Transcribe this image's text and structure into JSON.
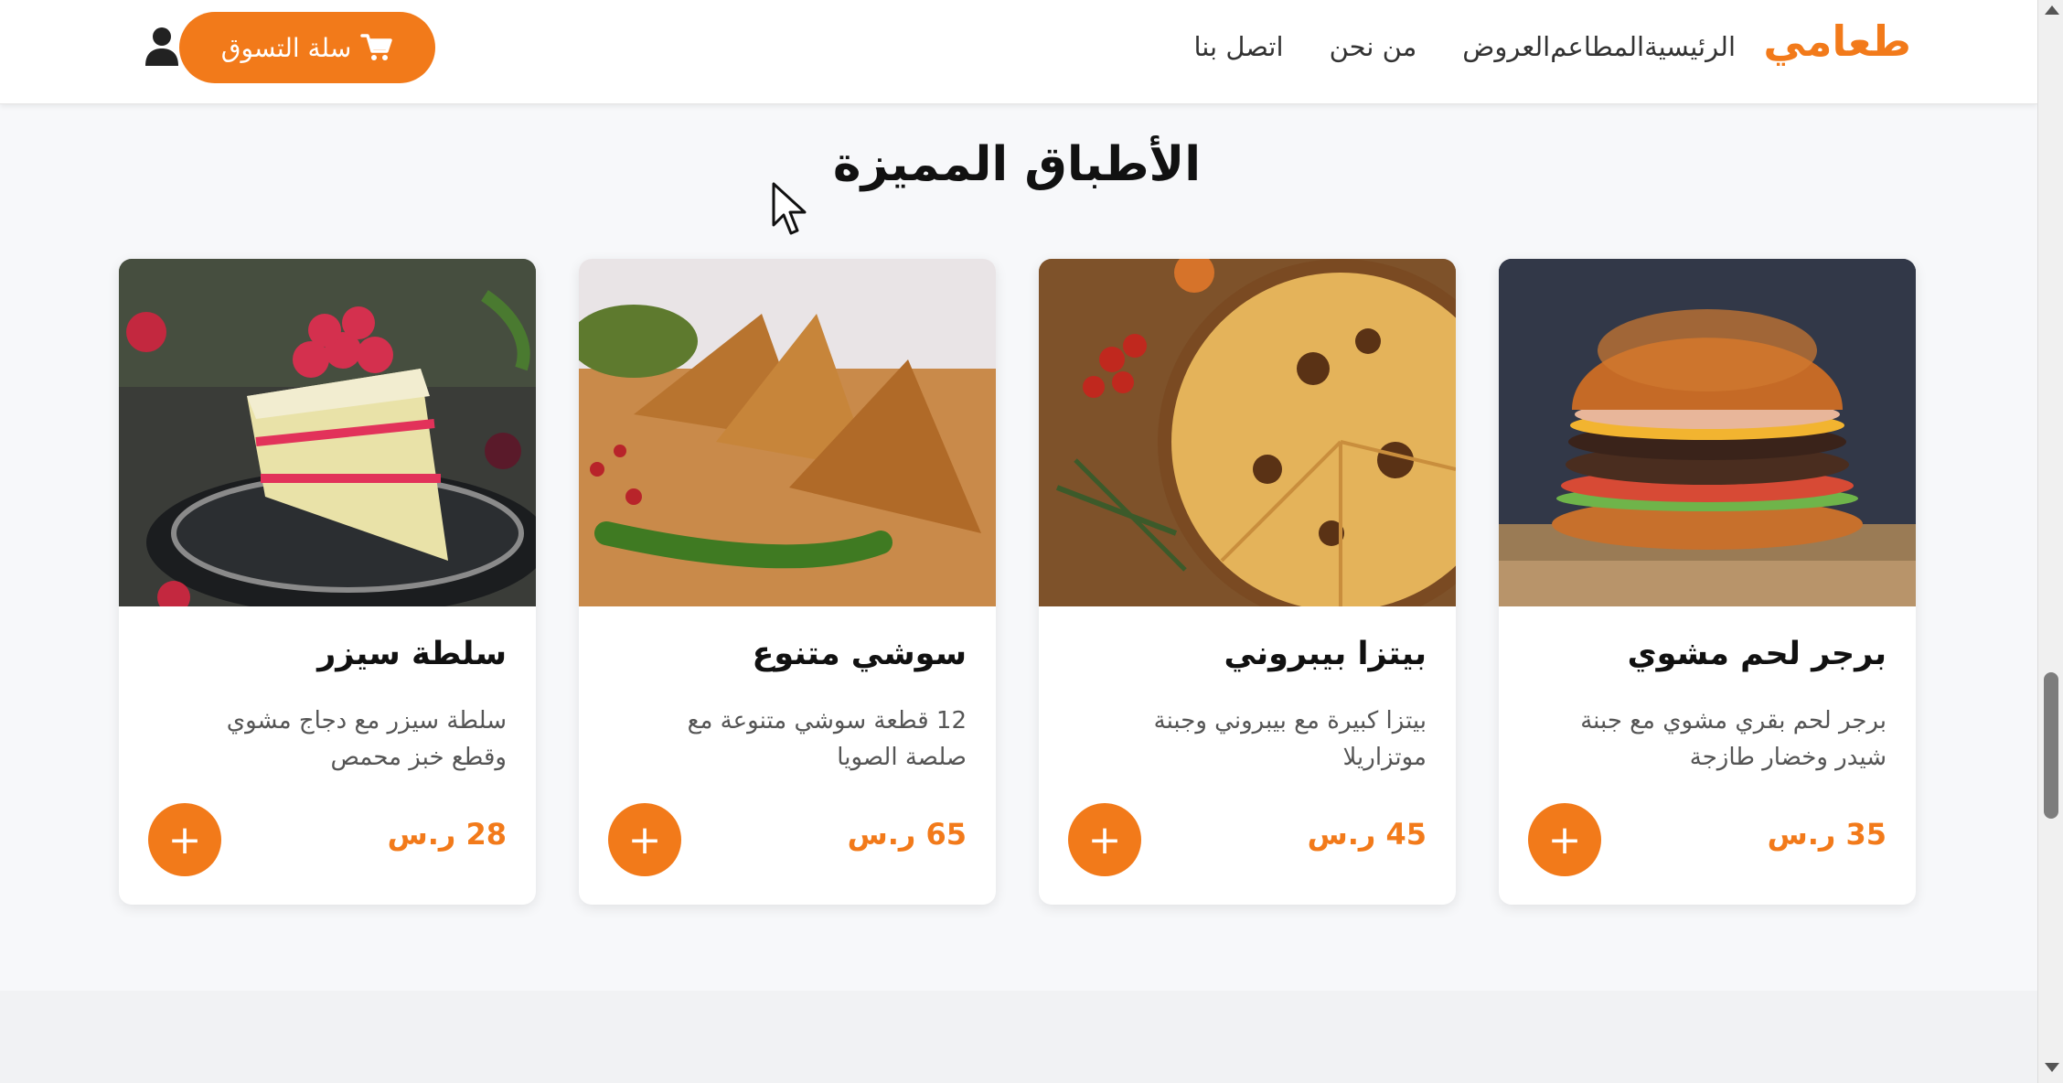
{
  "header": {
    "brand": "طعامي",
    "nav": [
      {
        "label": "الرئيسية"
      },
      {
        "label": "المطاعم"
      },
      {
        "label": "العروض"
      },
      {
        "label": "من نحن"
      },
      {
        "label": "اتصل بنا"
      }
    ],
    "cart_label": "سلة التسوق",
    "cart_icon": "shopping-cart-icon",
    "user_icon": "user-icon"
  },
  "section": {
    "title": "الأطباق المميزة"
  },
  "dishes": [
    {
      "name": "برجر لحم مشوي",
      "description": "برجر لحم بقري مشوي مع جبنة شيدر وخضار طازجة",
      "price": "35 ر.س",
      "add_label": "+",
      "image": "burger"
    },
    {
      "name": "بيتزا بيبروني",
      "description": "بيتزا كبيرة مع بيبروني وجبنة موتزاريلا",
      "price": "45 ر.س",
      "add_label": "+",
      "image": "pizza"
    },
    {
      "name": "سوشي متنوع",
      "description": "12 قطعة سوشي متنوعة مع صلصة الصويا",
      "price": "65 ر.س",
      "add_label": "+",
      "image": "samosa"
    },
    {
      "name": "سلطة سيزر",
      "description": "سلطة سيزر مع دجاج مشوي وقطع خبز محمص",
      "price": "28 ر.س",
      "add_label": "+",
      "image": "cake"
    }
  ],
  "colors": {
    "accent": "#f27a1a",
    "text": "#111111",
    "muted": "#555555",
    "background": "#f7f8fa"
  }
}
